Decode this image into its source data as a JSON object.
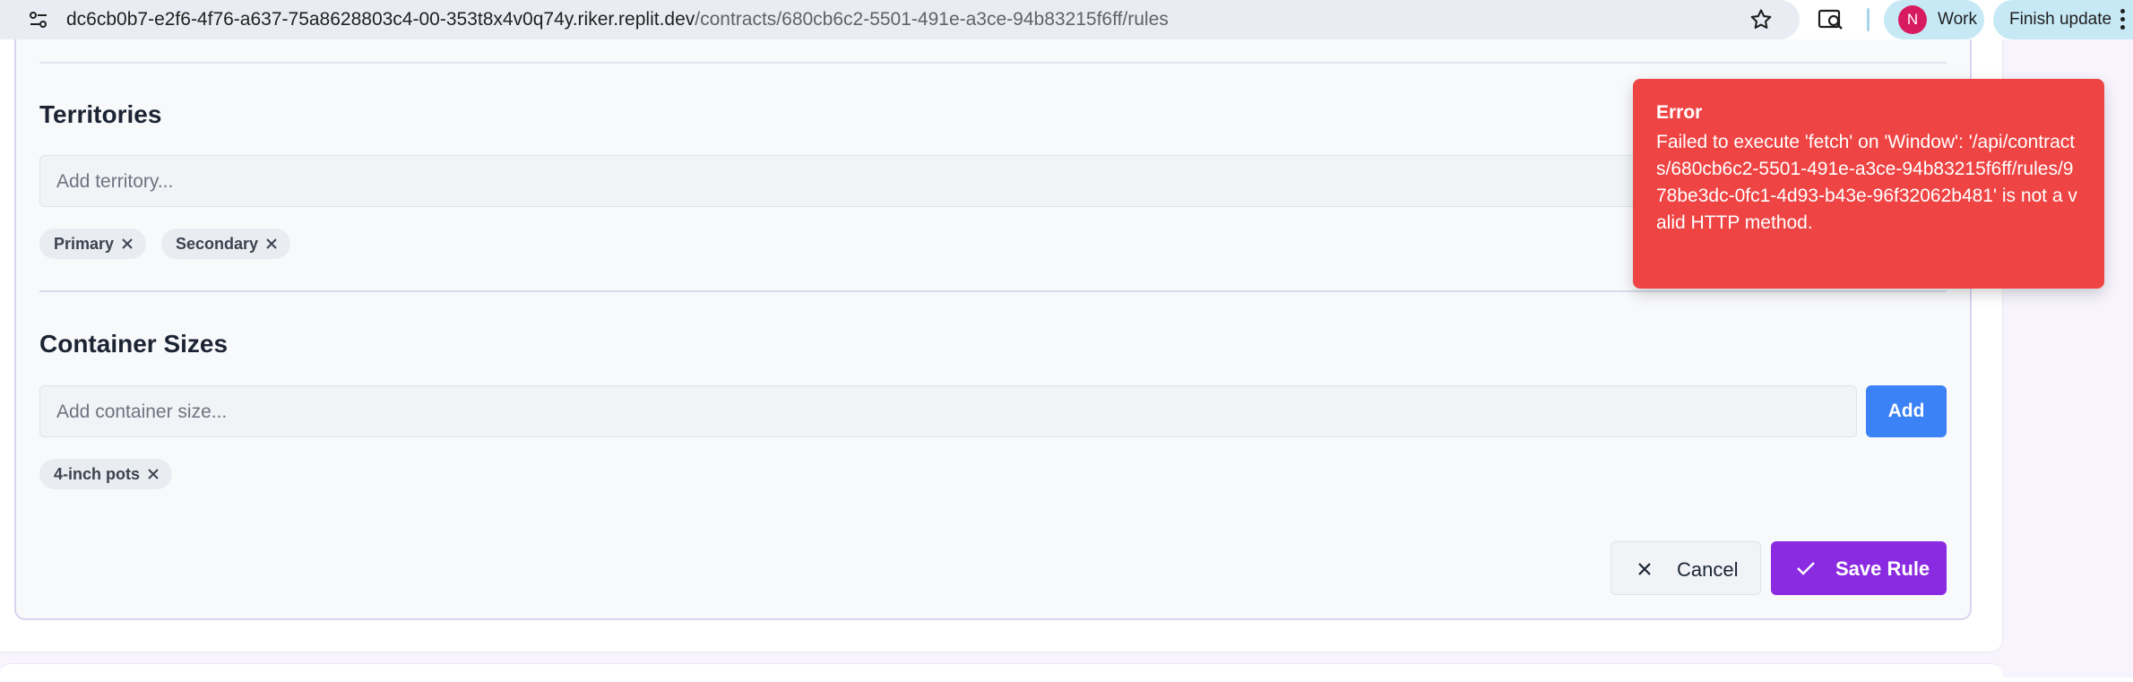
{
  "browser": {
    "url_host": "dc6cb0b7-e2f6-4f76-a637-75a8628803c4-00-353t8x4v0q74y.riker.replit.dev",
    "url_path": "/contracts/680cb6c2-5501-491e-a3ce-94b83215f6ff/rules",
    "profile_initial": "N",
    "profile_name": "Work",
    "update_label": "Finish update",
    "icons": [
      "site-info-icon",
      "star-icon",
      "lens-icon",
      "more-vert-icon"
    ],
    "avatar_color": "#d81b60"
  },
  "territories": {
    "title": "Territories",
    "input_placeholder": "Add territory...",
    "tags": [
      "Primary",
      "Secondary"
    ]
  },
  "container_sizes": {
    "title": "Container Sizes",
    "input_placeholder": "Add container size...",
    "add_label": "Add",
    "tags": [
      "4-inch pots"
    ]
  },
  "actions": {
    "cancel_label": "Cancel",
    "save_label": "Save Rule"
  },
  "toast": {
    "title": "Error",
    "message": "Failed to execute 'fetch' on 'Window': '/api/contracts/680cb6c2-5501-491e-a3ce-94b83215f6ff/rules/978be3dc-0fc1-4d93-b43e-96f32062b481' is not a valid HTTP method."
  },
  "colors": {
    "accent_blue": "#3b82f6",
    "save_purple": "#8a2be2",
    "error_red": "#ef4444"
  }
}
